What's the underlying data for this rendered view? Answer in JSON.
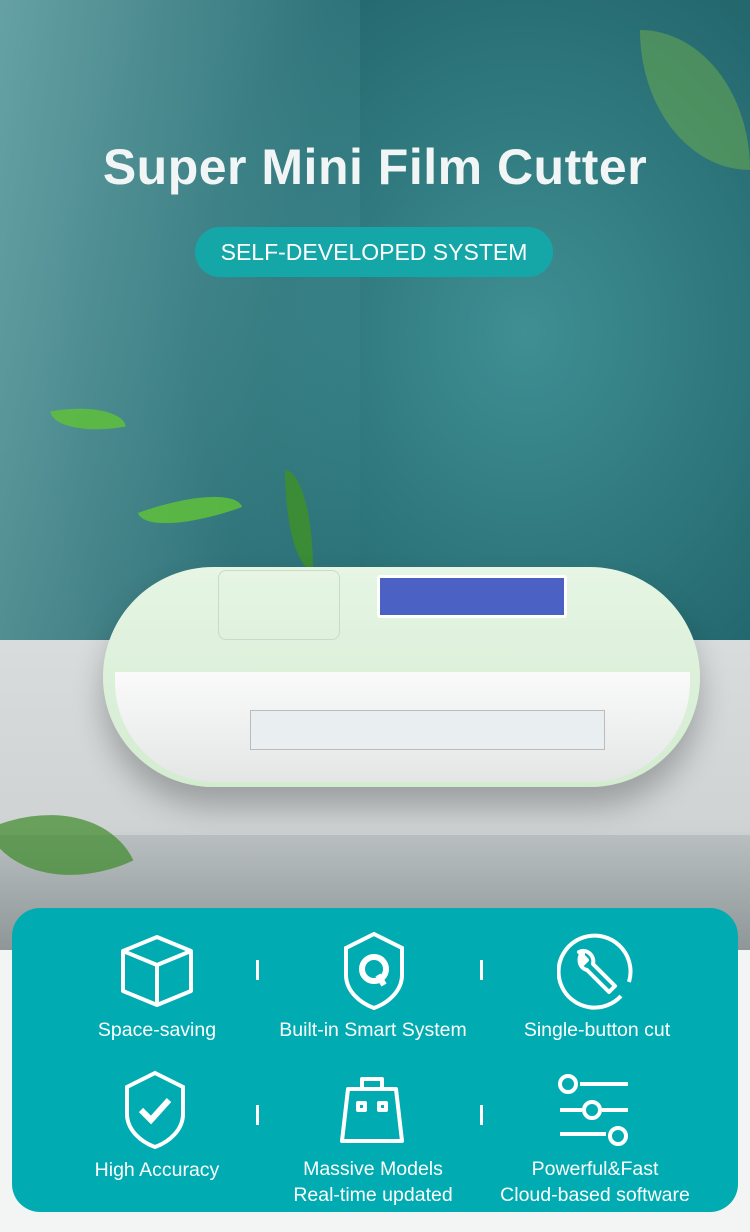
{
  "hero": {
    "title": "Super Mini Film Cutter",
    "badge": "SELF-DEVELOPED SYSTEM"
  },
  "colors": {
    "accent": "#00acb1",
    "badge": "#15a7a8",
    "background": "#24696f"
  },
  "features": [
    {
      "icon": "cube-icon",
      "label": "Space-saving"
    },
    {
      "icon": "shield-q-icon",
      "label": "Built-in Smart System"
    },
    {
      "icon": "wrench-circle-icon",
      "label": "Single-button cut"
    },
    {
      "icon": "shield-check-icon",
      "label": "High Accuracy"
    },
    {
      "icon": "shopping-bag-icon",
      "label_line1": "Massive Models",
      "label_line2": "Real-time updated"
    },
    {
      "icon": "sliders-icon",
      "label_line1": "Powerful&Fast",
      "label_line2": "Cloud-based software"
    }
  ]
}
